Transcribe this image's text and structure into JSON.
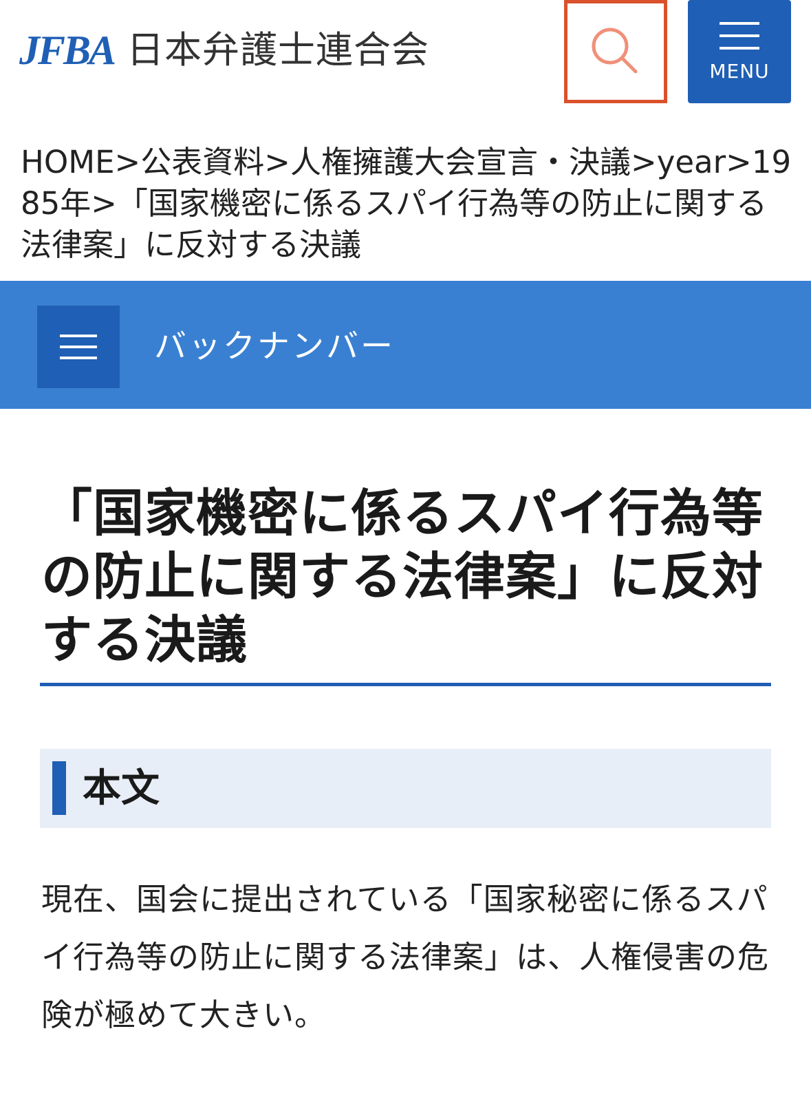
{
  "header": {
    "logo_mark": "JFBA",
    "logo_name": "日本弁護士連合会",
    "menu_label": "MENU"
  },
  "icons": {
    "search": "search-icon",
    "menu": "hamburger-icon",
    "back_number_menu": "hamburger-icon"
  },
  "breadcrumb": {
    "items": [
      "HOME",
      "公表資料",
      "人権擁護大会宣言・決議",
      "year",
      "1985年",
      "「国家機密に係るスパイ行為等の防止に関する法律案」に反対する決議"
    ],
    "separator": ">"
  },
  "back_number": {
    "label": "バックナンバー"
  },
  "article": {
    "title": "「国家機密に係るスパイ行為等の防止に関する法律案」に反対する決議",
    "section_heading": "本文",
    "body": "現在、国会に提出されている「国家秘密に係るスパイ行為等の防止に関する法律案」は、人権侵害の危険が極めて大きい。"
  },
  "colors": {
    "brand_blue": "#1f5fb5",
    "bar_blue": "#3a80d2",
    "search_highlight": "#d9522c",
    "search_icon": "#f0907a",
    "section_bg": "#e8eef7"
  }
}
